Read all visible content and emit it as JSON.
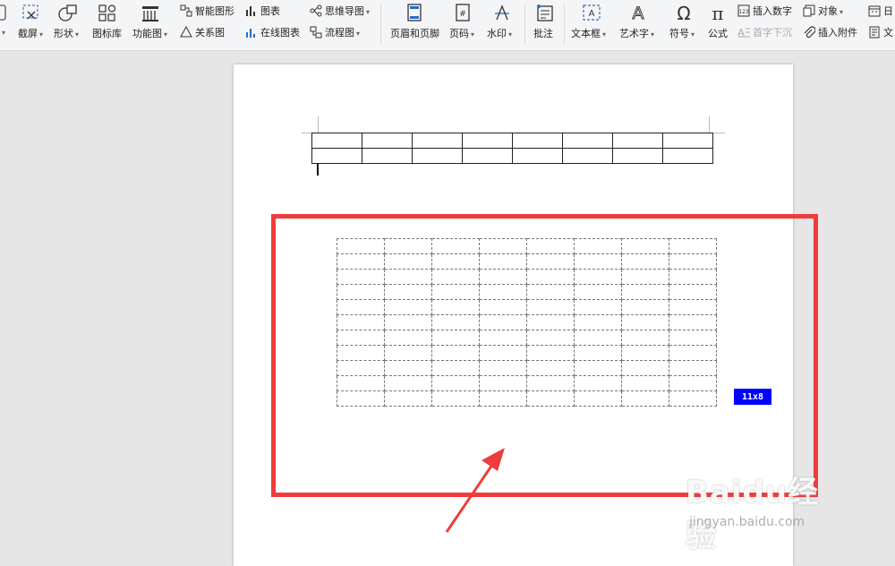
{
  "ribbon": {
    "screenshot_label": "截屏",
    "shapes_label": "形状",
    "icon_library_label": "图标库",
    "function_chart_label": "功能图",
    "smart_art_label": "智能图形",
    "chart_label": "图表",
    "mind_map_label": "思维导图",
    "relation_chart_label": "关系图",
    "online_chart_label": "在线图表",
    "flowchart_label": "流程图",
    "header_footer_label": "页眉和页脚",
    "page_number_label": "页码",
    "watermark_label": "水印",
    "comment_label": "批注",
    "text_box_label": "文本框",
    "word_art_label": "艺术字",
    "symbol_label": "符号",
    "formula_label": "公式",
    "insert_number_label": "插入数字",
    "object_label": "对象",
    "drop_cap_label": "首字下沉",
    "insert_attachment_label": "插入附件",
    "date_label": "日",
    "document_label": "文"
  },
  "document": {
    "table": {
      "rows": 2,
      "cols": 8
    }
  },
  "table_picker": {
    "rows": 11,
    "cols": 8,
    "size_label": "11x8"
  },
  "annotation": {
    "highlight_color": "#f03c3c",
    "arrow_color": "#f03c3c"
  },
  "watermark": {
    "logo_text": "Baidu经验",
    "url": "jingyan.baidu.com"
  },
  "colors": {
    "badge": "#0000ff",
    "ribbon_bg": "#f4f5f7",
    "canvas_bg": "#e6e6e6"
  }
}
